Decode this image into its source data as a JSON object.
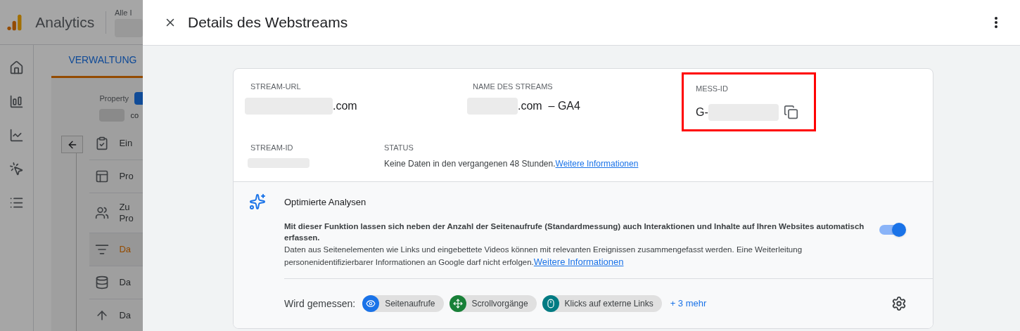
{
  "app": {
    "name": "Analytics",
    "account_label": "Alle I",
    "admin_tab": "VERWALTUNG",
    "property_label": "Property",
    "property_value": "co",
    "menu": [
      {
        "label": "Ein",
        "selected": false
      },
      {
        "label": "Pro",
        "selected": false
      },
      {
        "label": "Zu Pro",
        "selected": false
      },
      {
        "label": "Da",
        "selected": true
      },
      {
        "label": "Da",
        "selected": false
      },
      {
        "label": "Da",
        "selected": false
      }
    ]
  },
  "dialog": {
    "title": "Details des Webstreams",
    "stream_url": {
      "label": "STREAM-URL",
      "value": ".com"
    },
    "stream_name": {
      "label": "NAME DES STREAMS",
      "value": ".com  – GA4"
    },
    "measurement_id": {
      "label": "MESS-ID",
      "value": "G-",
      "highlighted": true
    },
    "stream_id": {
      "label": "STREAM-ID"
    },
    "status": {
      "label": "STATUS",
      "value": "Keine Daten in den vergangenen 48 Stunden.",
      "link": "Weitere Informationen"
    },
    "enhanced": {
      "title": "Optimierte Analysen",
      "on": true,
      "description_1": "Mit dieser Funktion lassen sich neben der Anzahl der Seitenaufrufe (Standardmessung) auch Interaktionen und Inhalte auf Ihren Websites automatisch erfassen.",
      "description_2": "Daten aus Seitenelementen wie Links und eingebettete Videos können mit relevanten Ereignissen zusammengefasst werden. Eine Weiterleitung personenidentifizierbarer Informationen an Google darf nicht erfolgen.",
      "link": "Weitere Informationen",
      "measured_label": "Wird gemessen:",
      "events": [
        {
          "label": "Seitenaufrufe",
          "kind": "eye",
          "color": "#1a73e8"
        },
        {
          "label": "Scrollvorgänge",
          "kind": "scroll",
          "color": "#188038"
        },
        {
          "label": "Klicks auf externe Links",
          "kind": "click",
          "color": "#007b83"
        }
      ],
      "more": "+ 3 mehr"
    }
  }
}
